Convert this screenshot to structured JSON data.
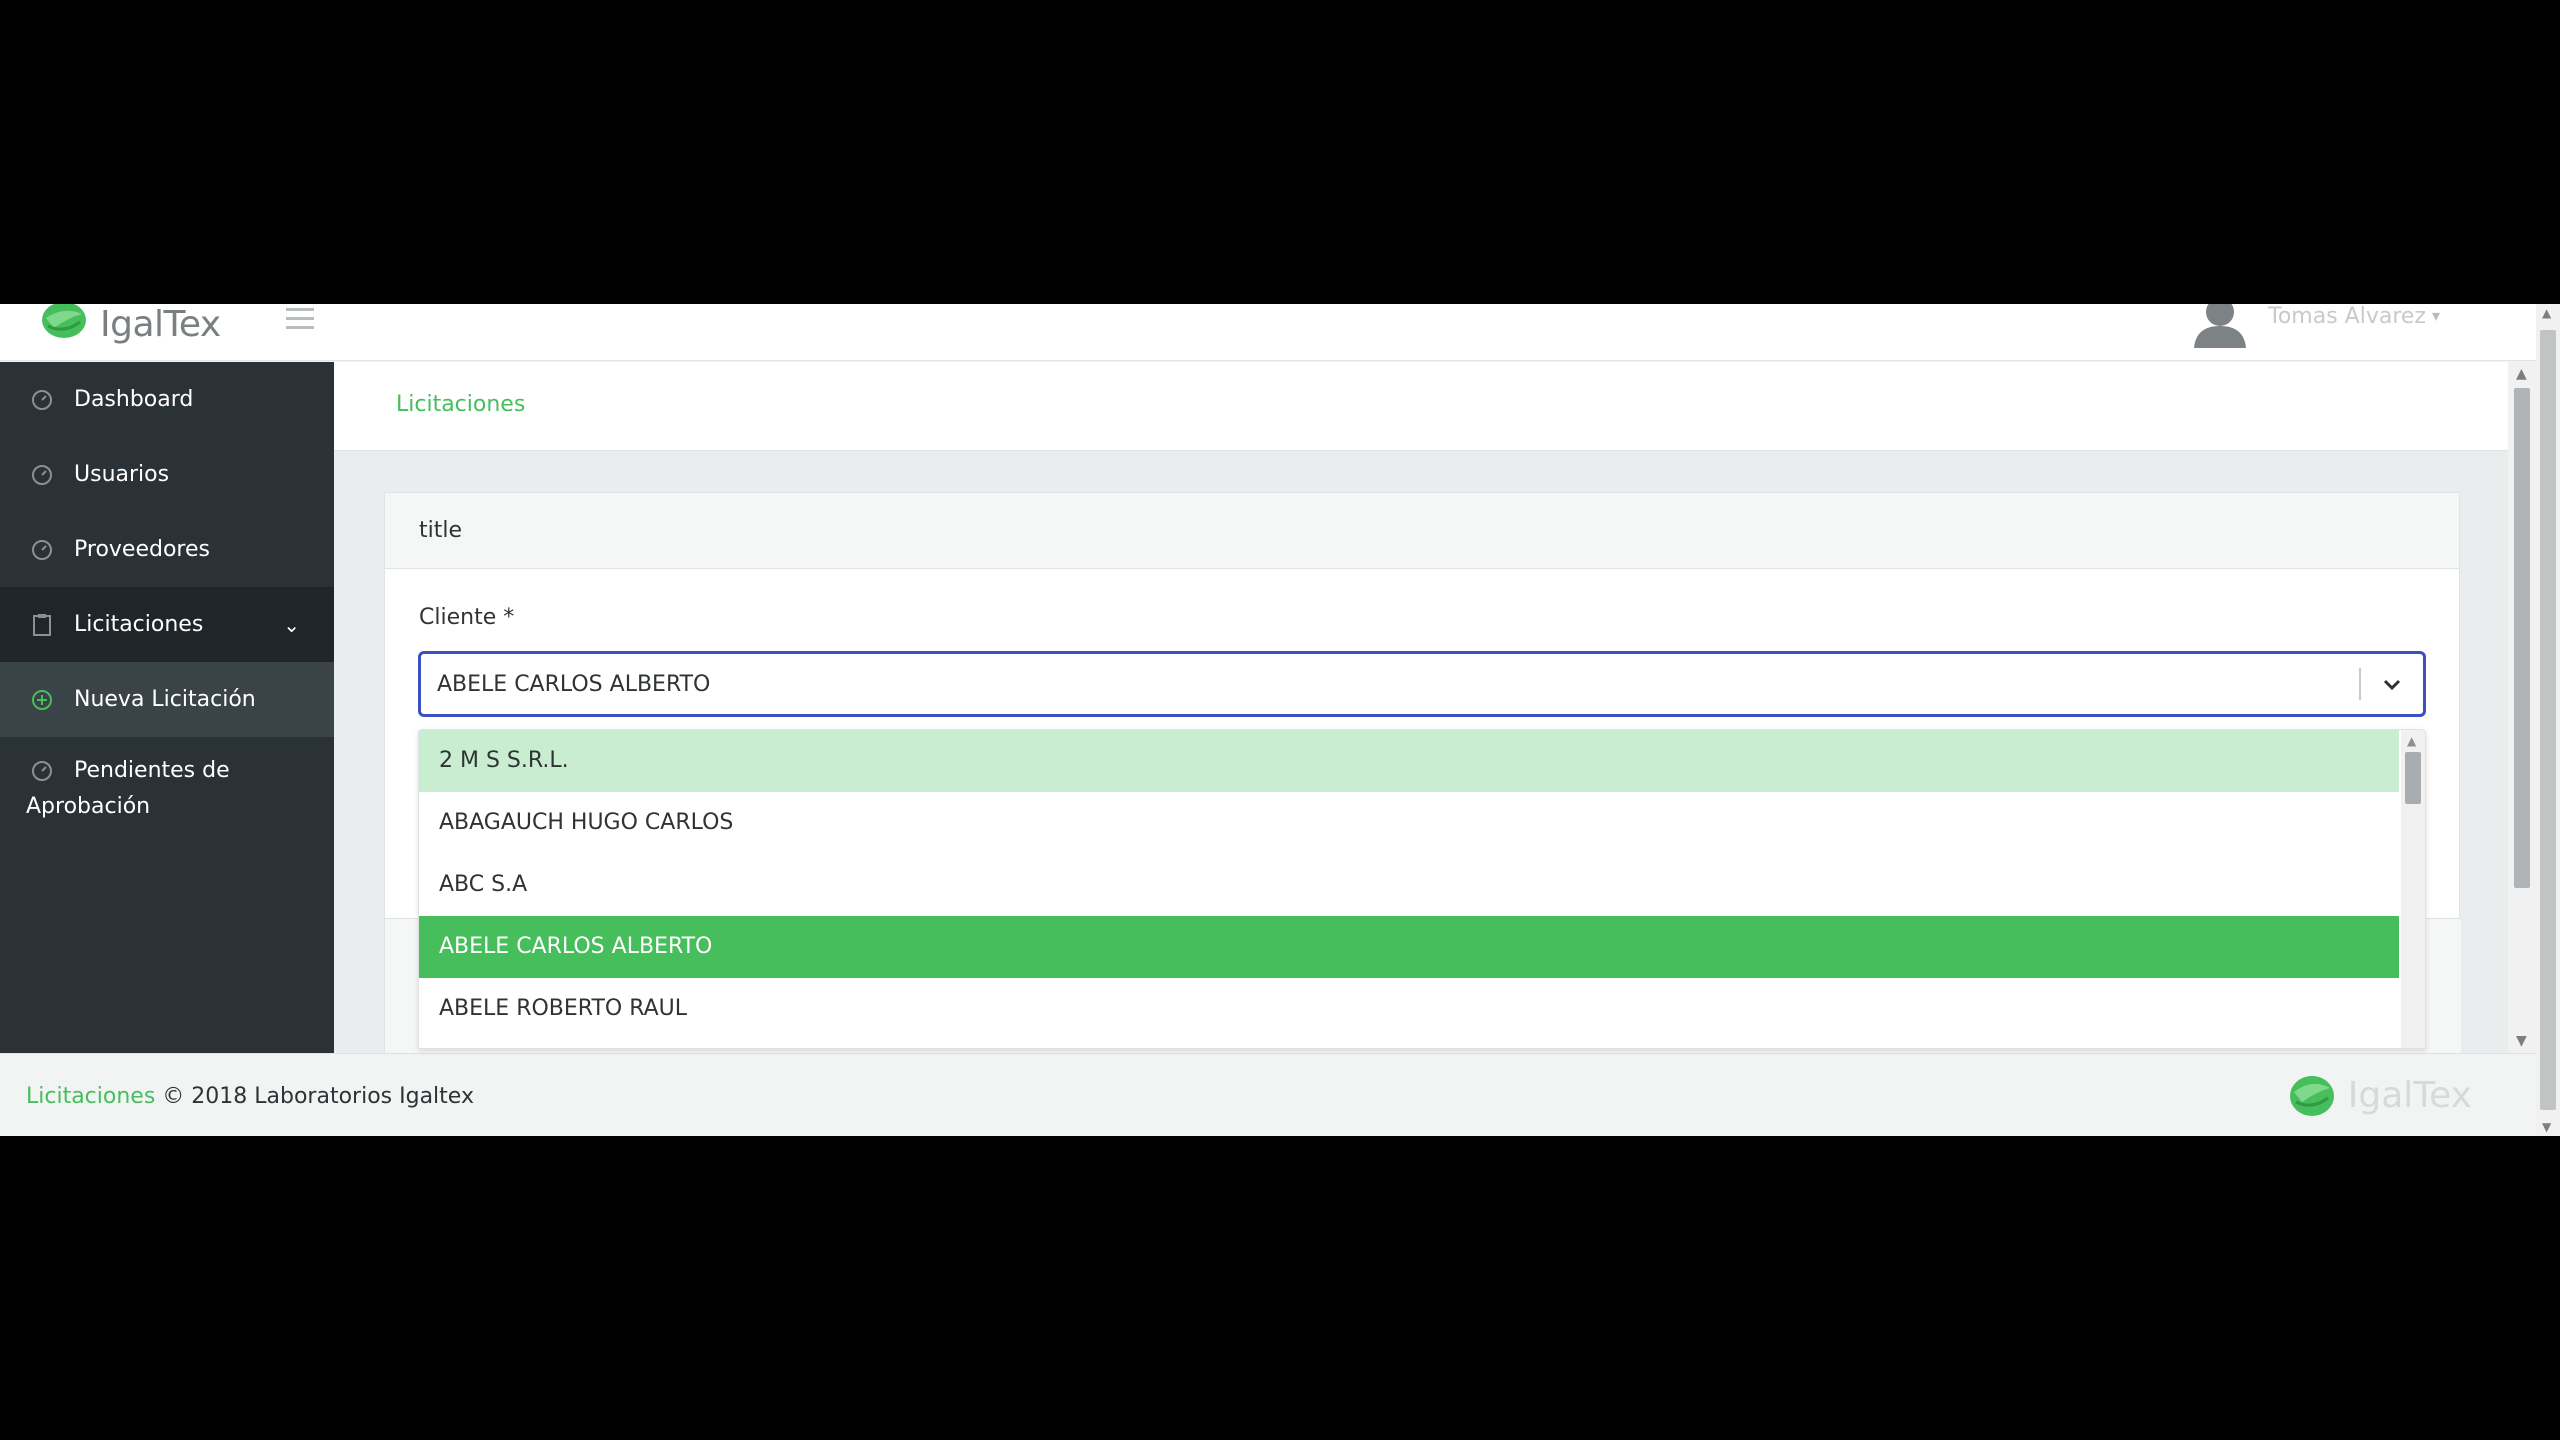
{
  "brand": {
    "name": "IgalTex",
    "accent": "#46be5c",
    "sidebar_bg": "#2a3137",
    "focus_border": "#3d50c2"
  },
  "header": {
    "user_name": "Tomas Alvarez"
  },
  "sidebar": {
    "items": [
      {
        "label": "Dashboard",
        "icon": "dashboard-icon"
      },
      {
        "label": "Usuarios",
        "icon": "dashboard-icon"
      },
      {
        "label": "Proveedores",
        "icon": "dashboard-icon"
      },
      {
        "label": "Licitaciones",
        "icon": "clipboard-icon"
      },
      {
        "label": "Nueva Licitación",
        "icon": "plus-circle-icon"
      },
      {
        "label": "Pendientes de Aprobación",
        "icon": "dashboard-icon"
      }
    ]
  },
  "breadcrumb": {
    "current": "Licitaciones"
  },
  "card": {
    "title": "title"
  },
  "form": {
    "cliente_label": "Cliente *",
    "cliente_value": "ABELE CARLOS ALBERTO",
    "options": [
      "2 M S S.R.L.",
      "ABAGAUCH HUGO CARLOS",
      "ABC S.A",
      "ABELE CARLOS ALBERTO",
      "ABELE ROBERTO RAUL"
    ]
  },
  "footer": {
    "link": "Licitaciones",
    "text": "© 2018 Laboratorios Igaltex"
  }
}
